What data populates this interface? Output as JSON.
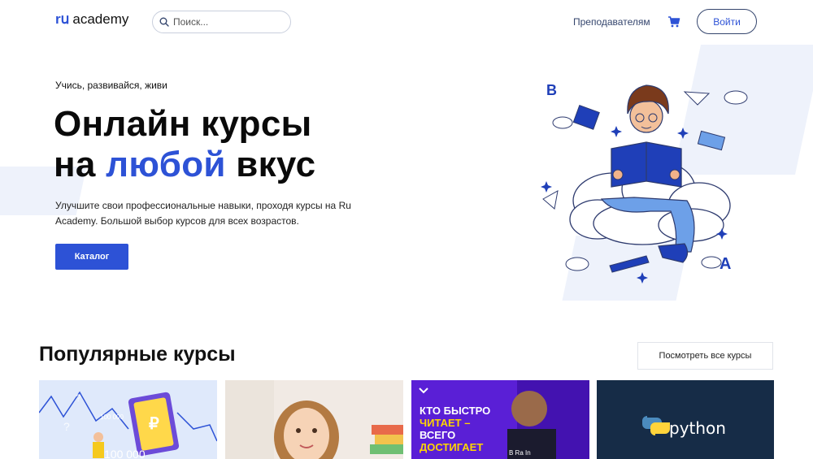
{
  "header": {
    "logo_mark": "rս",
    "logo_text": "academy",
    "search_placeholder": "Поиск...",
    "teachers_link": "Преподавателям",
    "login_label": "Войти",
    "cart_icon": "cart-icon"
  },
  "hero": {
    "tagline": "Учись, развивайся, живи",
    "title_line1": "Онлайн курсы",
    "title_line2_prefix": "на ",
    "title_line2_accent": "любой",
    "title_line2_suffix": " вкус",
    "description": "Улучшите свои профессиональные навыки, проходя курсы на Ru Academy. Большой выбор курсов для всех возрастов.",
    "catalog_button": "Каталог"
  },
  "popular": {
    "title": "Популярные курсы",
    "view_all_button": "Посмотреть все курсы",
    "cards": [
      {
        "image": "finance-illustration",
        "text": "100 000"
      },
      {
        "image": "girl-with-books"
      },
      {
        "image": "speed-reading",
        "lines": [
          "КТО БЫСТРО",
          "ЧИТАЕТ –",
          "ВСЕГО",
          "ДОСТИГАЕТ"
        ],
        "shirt": "B Ra In"
      },
      {
        "image": "python-logo",
        "text": "python"
      }
    ]
  },
  "colors": {
    "accent": "#2d52d6",
    "nav_text": "#34456d",
    "card3_bg": "#5a1fd6",
    "card4_bg": "#162c47",
    "highlight_yellow": "#ffd500"
  }
}
